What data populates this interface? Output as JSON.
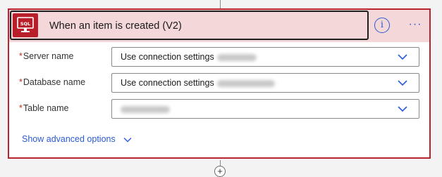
{
  "trigger": {
    "title": "When an item is created (V2)",
    "icon": "sql-server-icon",
    "icon_text": "SQL",
    "brand_color": "#b81f2a",
    "header_bg": "#f3d7d9"
  },
  "actions": {
    "info_symbol": "i",
    "more_symbol": "···"
  },
  "fields": [
    {
      "label": "Server name",
      "required_mark": "*",
      "value": "Use connection settings",
      "redacted": true
    },
    {
      "label": "Database name",
      "required_mark": "*",
      "value": "Use connection settings",
      "redacted": true
    },
    {
      "label": "Table name",
      "required_mark": "*",
      "value": "",
      "redacted": true
    }
  ],
  "advanced": {
    "label": "Show advanced options"
  },
  "add_step": {
    "symbol": "+"
  },
  "colors": {
    "accent": "#2a5bd7",
    "required": "#c42b1c",
    "card_border": "#b8232d"
  }
}
